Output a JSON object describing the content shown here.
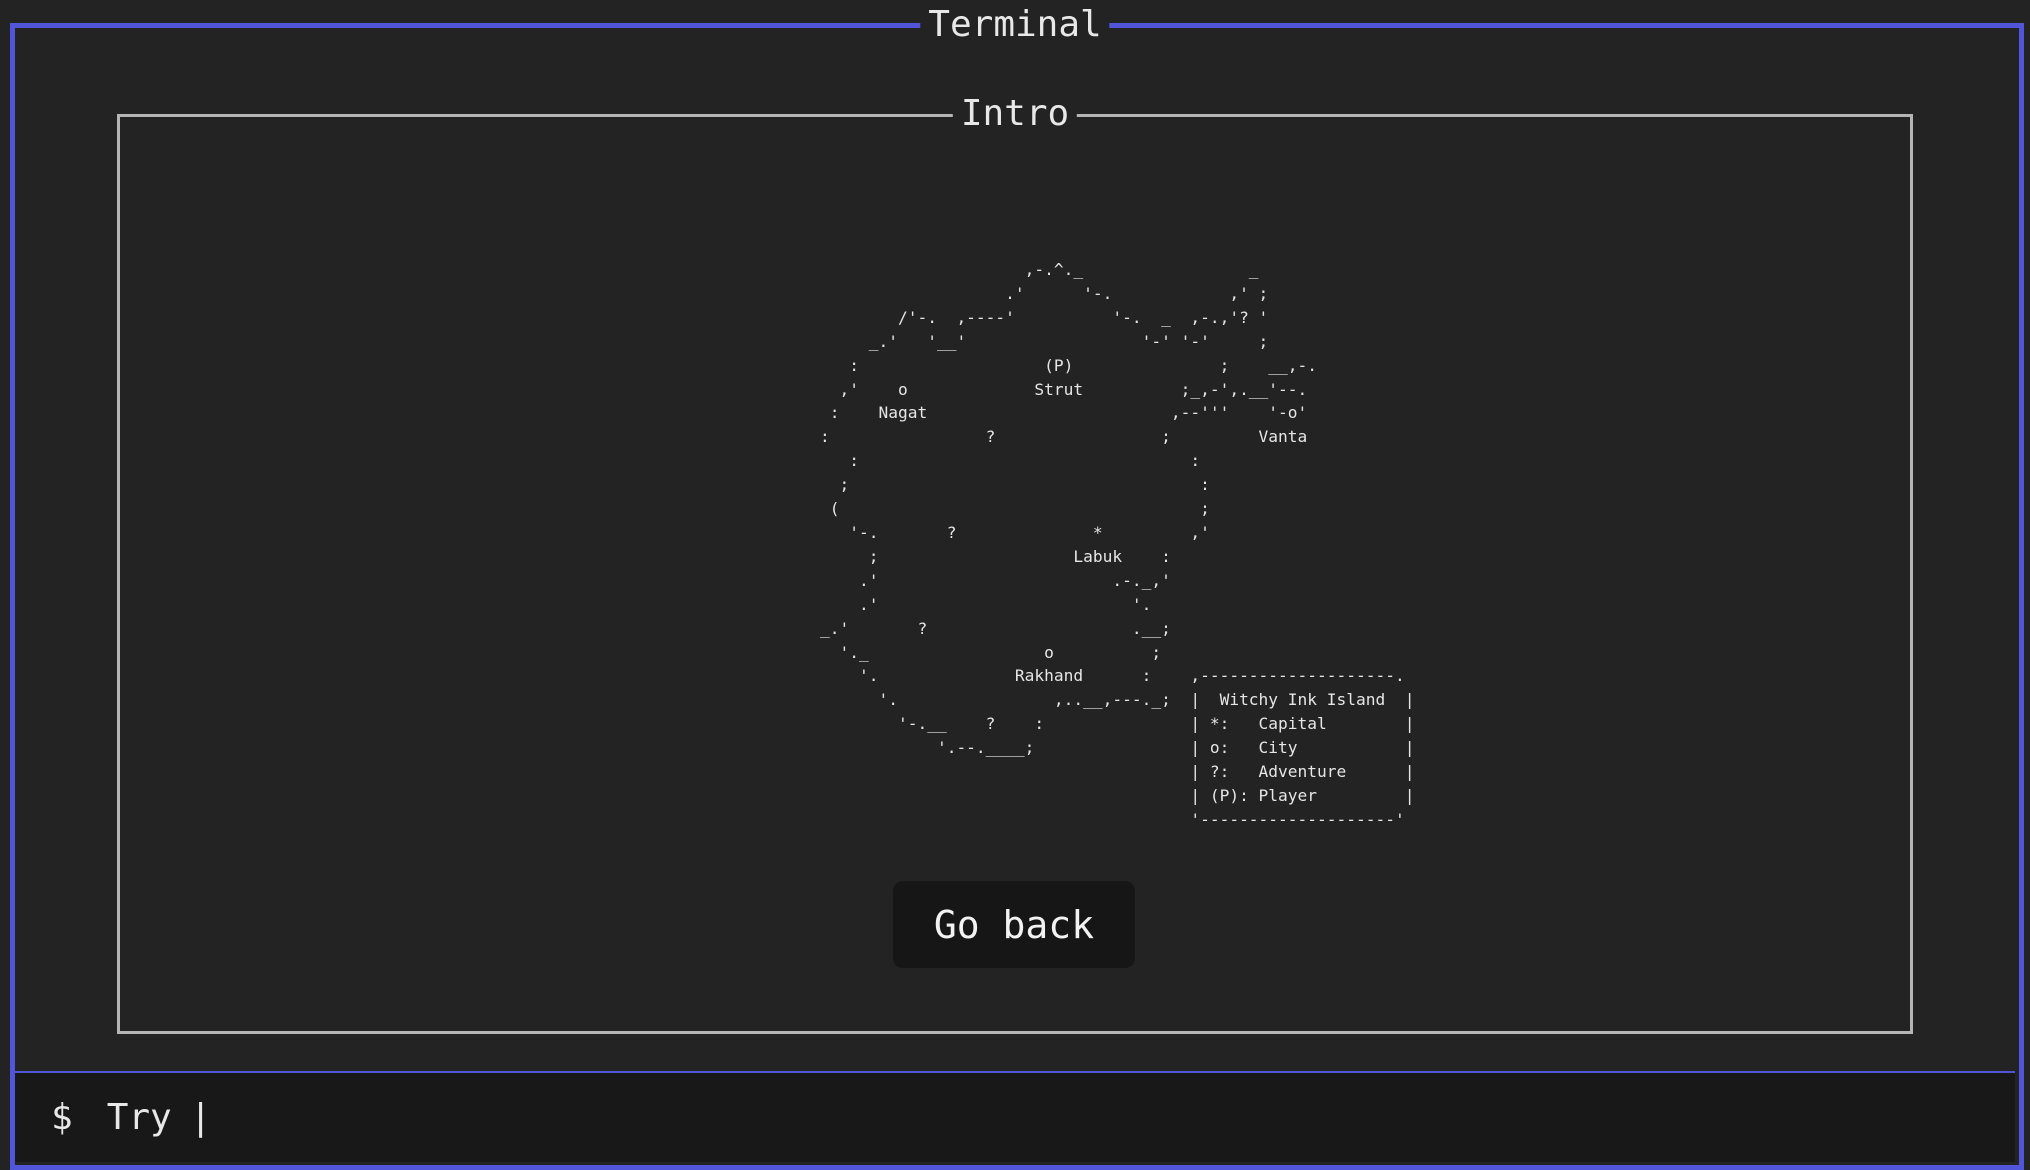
{
  "window": {
    "title": "Terminal"
  },
  "panel": {
    "title": "Intro",
    "map_ascii": "                     ,-.^._                 _\n                   .'      '-.            ,' ;\n        /'-.  ,----'          '-.  _  ,-.,'? '\n     _.'   '__'                  '-' '-'     ;\n   :                   (P)               ;    __,-.\n  ,'    o             Strut          ;_,-',.__'--.\n :    Nagat                         ,--'''    '-o'\n:                ?                 ;         Vanta\n   :                                  :\n  ;                                    :\n (                                     ;\n   '-.       ?              *         ,'\n     ;                    Labuk    :\n    .'                        .-._,'\n    .'                          '.\n_.'       ?                     .__;\n  '._                  o          ;\n    '.              Rakhand      :    ,--------------------.\n      '.                ,..__,---._;  |  Witchy Ink Island  |\n        '-.__    ?    :               | *:   Capital        |\n            '.--.____;                | o:   City           |\n                                      | ?:   Adventure      |\n                                      | (P): Player         |\n                                      '--------------------'",
    "go_back_label": "Go back"
  },
  "input": {
    "prompt": "$",
    "value": "Try",
    "cursor": "|"
  }
}
